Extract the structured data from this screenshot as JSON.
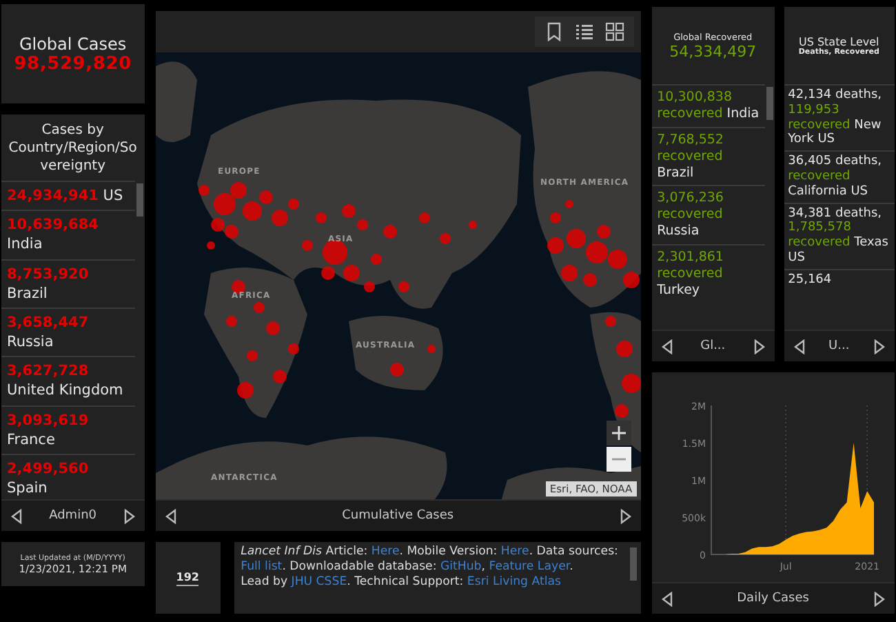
{
  "global_cases": {
    "title": "Global Cases",
    "value": "98,529,820"
  },
  "cases_list": {
    "title": "Cases by Country/Region/Sovereignty",
    "items": [
      {
        "value": "24,934,941",
        "name": "US"
      },
      {
        "value": "10,639,684",
        "name": "India"
      },
      {
        "value": "8,753,920",
        "name": "Brazil"
      },
      {
        "value": "3,658,447",
        "name": "Russia"
      },
      {
        "value": "3,627,728",
        "name": "United Kingdom"
      },
      {
        "value": "3,093,619",
        "name": "France"
      },
      {
        "value": "2,499,560",
        "name": "Spain"
      }
    ],
    "nav": {
      "label": "Admin0"
    }
  },
  "last_updated": {
    "label": "Last Updated at (M/D/YYYY)",
    "value": "1/23/2021, 12:21 PM"
  },
  "map": {
    "labels": [
      "EUROPE",
      "ASIA",
      "AFRICA",
      "AUSTRALIA",
      "NORTH AMERICA",
      "ANTARCTICA"
    ],
    "attribution": "Esri, FAO, NOAA",
    "nav": {
      "label": "Cumulative Cases"
    }
  },
  "count_box": {
    "value": "192"
  },
  "info": {
    "paragraphs": [
      [
        {
          "kind": "italic",
          "text": "Lancet Inf Dis"
        },
        {
          "kind": "plain",
          "text": " Article: "
        },
        {
          "kind": "link",
          "text": "Here"
        },
        {
          "kind": "plain",
          "text": ". Mobile Version: "
        },
        {
          "kind": "link",
          "text": "Here"
        },
        {
          "kind": "plain",
          "text": ". Data sources: "
        },
        {
          "kind": "link",
          "text": "Full list"
        },
        {
          "kind": "plain",
          "text": ". Downloadable database: "
        },
        {
          "kind": "link",
          "text": "GitHub"
        },
        {
          "kind": "plain",
          "text": ", "
        },
        {
          "kind": "link",
          "text": "Feature Layer"
        },
        {
          "kind": "plain",
          "text": "."
        }
      ],
      [
        {
          "kind": "plain",
          "text": "Lead by "
        },
        {
          "kind": "link",
          "text": "JHU CSSE"
        },
        {
          "kind": "plain",
          "text": ". Technical Support: "
        },
        {
          "kind": "link",
          "text": "Esri Living Atlas"
        }
      ]
    ]
  },
  "recovered": {
    "title": "Global Recovered",
    "value": "54,334,497",
    "items": [
      {
        "value": "10,300,838",
        "label": "recovered",
        "name": "India"
      },
      {
        "value": "7,768,552",
        "label": "recovered",
        "name": "Brazil"
      },
      {
        "value": "3,076,236",
        "label": "recovered",
        "name": "Russia"
      },
      {
        "value": "2,301,861",
        "label": "recovered",
        "name": "Turkey"
      }
    ],
    "nav": {
      "label": "Gl..."
    }
  },
  "us_states": {
    "title": "US State Level",
    "subtitle": "Deaths, Recovered",
    "items": [
      {
        "deaths": "42,134",
        "deaths_label": "deaths,",
        "recovered": "119,953",
        "recovered_label": "recovered",
        "name": "New York US"
      },
      {
        "deaths": "36,405",
        "deaths_label": "deaths,",
        "recovered_label": "recovered",
        "name": "California US"
      },
      {
        "deaths": "34,381",
        "deaths_label": "deaths,",
        "recovered": "1,785,578",
        "recovered_label": "recovered",
        "name": "Texas US"
      },
      {
        "deaths": "25,164"
      }
    ],
    "nav": {
      "label": "U..."
    }
  },
  "daily_chart": {
    "chart_data": {
      "type": "area",
      "categories": [
        null,
        null,
        null,
        null,
        null,
        null,
        null,
        null,
        null,
        null,
        null,
        "Jul",
        null,
        null,
        null,
        null,
        null,
        null,
        null,
        null,
        null,
        null,
        null,
        "2021",
        null
      ],
      "series": [
        {
          "name": "Daily Cases",
          "color": "#ffaa00",
          "values": [
            0,
            0,
            0,
            10000,
            10000,
            30000,
            80000,
            100000,
            100000,
            110000,
            140000,
            200000,
            250000,
            280000,
            300000,
            310000,
            330000,
            360000,
            450000,
            600000,
            700000,
            1500000,
            620000,
            850000,
            700000
          ]
        }
      ],
      "ylim": [
        0,
        2000000
      ],
      "yticks": [
        {
          "value": 0,
          "label": "0"
        },
        {
          "value": 500000,
          "label": "500k"
        },
        {
          "value": 1000000,
          "label": "1M"
        },
        {
          "value": 1500000,
          "label": "1.5M"
        },
        {
          "value": 2000000,
          "label": "2M"
        }
      ]
    }
  }
}
